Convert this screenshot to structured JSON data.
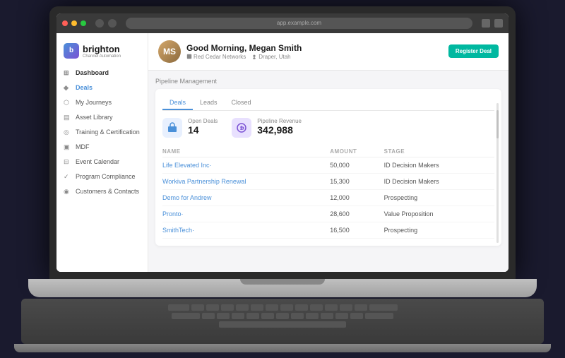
{
  "browser": {
    "url": "app.example.com"
  },
  "sidebar": {
    "logo": {
      "text": "brighton",
      "subtitle": "Channel Automation"
    },
    "items": [
      {
        "id": "dashboard",
        "label": "Dashboard",
        "icon": "⊞"
      },
      {
        "id": "deals",
        "label": "Deals",
        "icon": "◈",
        "active": true
      },
      {
        "id": "my-journeys",
        "label": "My Journeys",
        "icon": "⬡"
      },
      {
        "id": "asset-library",
        "label": "Asset Library",
        "icon": "▤"
      },
      {
        "id": "training",
        "label": "Training & Certification",
        "icon": "◎"
      },
      {
        "id": "mdf",
        "label": "MDF",
        "icon": "▣"
      },
      {
        "id": "event-calendar",
        "label": "Event Calendar",
        "icon": "⊟"
      },
      {
        "id": "compliance",
        "label": "Program Compliance",
        "icon": "✓"
      },
      {
        "id": "customers",
        "label": "Customers & Contacts",
        "icon": "◉"
      }
    ]
  },
  "header": {
    "greeting": "Good Morning, Megan Smith",
    "company": "Red Cedar Networks",
    "location": "Draper, Utah",
    "register_btn": "Register Deal"
  },
  "pipeline": {
    "section_label": "Pipeline Management",
    "tabs": [
      "Deals",
      "Leads",
      "Closed"
    ],
    "active_tab": "Deals",
    "stats": {
      "open_deals_label": "Open Deals",
      "open_deals_value": "14",
      "pipeline_revenue_label": "Pipeline Revenue",
      "pipeline_revenue_value": "342,988"
    },
    "table": {
      "columns": [
        "NAME",
        "AMOUNT",
        "STAGE"
      ],
      "rows": [
        {
          "name": "Life Elevated Inc·",
          "amount": "50,000",
          "stage": "ID Decision Makers"
        },
        {
          "name": "Workiva Partnership Renewal",
          "amount": "15,300",
          "stage": "ID Decision Makers"
        },
        {
          "name": "Demo for Andrew",
          "amount": "12,000",
          "stage": "Prospecting"
        },
        {
          "name": "Pronto·",
          "amount": "28,600",
          "stage": "Value Proposition"
        },
        {
          "name": "SmithTech·",
          "amount": "16,500",
          "stage": "Prospecting"
        }
      ]
    }
  }
}
